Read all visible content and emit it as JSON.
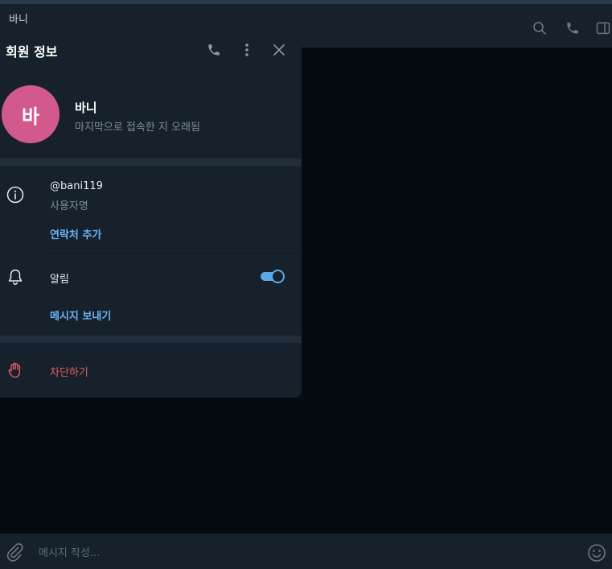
{
  "chat": {
    "title": "바니",
    "composer_placeholder": "메시지 작성..."
  },
  "panel": {
    "title": "회원 정보",
    "avatar_initial": "바",
    "avatar_color": "#d2598b",
    "name": "바니",
    "last_seen": "마지막으로 접속한 지 오래됨",
    "username": "@bani119",
    "username_label": "사용자명",
    "add_contact": "연락처 추가",
    "notifications_label": "알림",
    "notifications_enabled": true,
    "send_message": "메시지 보내기",
    "block": "차단하기"
  },
  "colors": {
    "accent": "#6ab3f3",
    "danger": "#e25d61",
    "panel_bg": "#17212b"
  },
  "icons": {
    "header": [
      "search-icon",
      "phone-icon",
      "sidebar-toggle-icon"
    ],
    "panel": [
      "phone-icon",
      "more-vertical-icon",
      "close-icon"
    ],
    "rows": [
      "info-icon",
      "bell-icon",
      "hand-block-icon"
    ],
    "composer": [
      "paperclip-icon",
      "emoji-icon"
    ]
  }
}
